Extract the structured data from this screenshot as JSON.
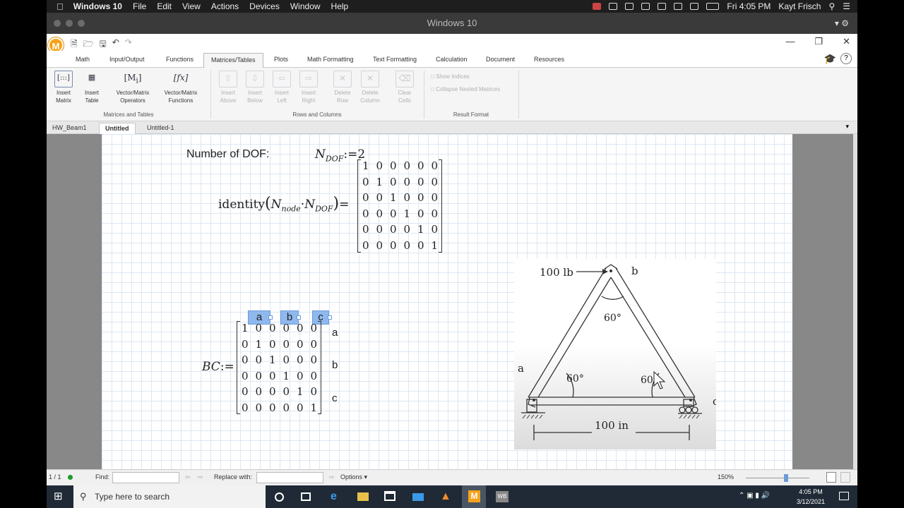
{
  "mac_menu": {
    "app_name": "Windows 10",
    "items": [
      "File",
      "Edit",
      "View",
      "Actions",
      "Devices",
      "Window",
      "Help"
    ],
    "datetime": "Fri 4:05 PM",
    "user": "Kayt Frisch"
  },
  "vm_title": "Windows 10",
  "ribbon": {
    "tabs": [
      "Math",
      "Input/Output",
      "Functions",
      "Matrices/Tables",
      "Plots",
      "Math Formatting",
      "Text Formatting",
      "Calculation",
      "Document",
      "Resources"
    ],
    "active_tab": "Matrices/Tables",
    "groups": {
      "matrices_and_tables": {
        "label": "Matrices and Tables",
        "buttons": [
          {
            "label1": "Insert",
            "label2": "Matrix",
            "icon": "insert-matrix-icon"
          },
          {
            "label1": "Insert",
            "label2": "Table",
            "icon": "insert-table-icon"
          },
          {
            "label1": "Vector/Matrix",
            "label2": "Operators",
            "icon": "matrix-operators-icon"
          },
          {
            "label1": "Vector/Matrix",
            "label2": "Functions",
            "icon": "matrix-functions-icon"
          }
        ]
      },
      "rows_and_columns": {
        "label": "Rows and Columns",
        "buttons": [
          {
            "label1": "Insert",
            "label2": "Above"
          },
          {
            "label1": "Insert",
            "label2": "Below"
          },
          {
            "label1": "Insert",
            "label2": "Left"
          },
          {
            "label1": "Insert",
            "label2": "Right"
          },
          {
            "label1": "Delete",
            "label2": "Row"
          },
          {
            "label1": "Delete",
            "label2": "Column"
          },
          {
            "label1": "Clear",
            "label2": "Cells"
          }
        ]
      },
      "result_format": {
        "label": "Result Format",
        "options": [
          "Show Indices",
          "Collapse Nested Matrices"
        ]
      }
    }
  },
  "doc_tabs": [
    "HW_Beam1",
    "Untitled",
    "Untitled-1"
  ],
  "active_doc_tab": "Untitled",
  "worksheet": {
    "dof_label": "Number of DOF:",
    "ndof_def": {
      "var": "N",
      "sub": "DOF",
      "op": ":=",
      "value": "2"
    },
    "identity_expr": {
      "fn": "identity",
      "arg1": "N",
      "sub1": "node",
      "dot": "·",
      "arg2": "N",
      "sub2": "DOF",
      "eq": "="
    },
    "identity_matrix": [
      [
        1,
        0,
        0,
        0,
        0,
        0
      ],
      [
        0,
        1,
        0,
        0,
        0,
        0
      ],
      [
        0,
        0,
        1,
        0,
        0,
        0
      ],
      [
        0,
        0,
        0,
        1,
        0,
        0
      ],
      [
        0,
        0,
        0,
        0,
        1,
        0
      ],
      [
        0,
        0,
        0,
        0,
        0,
        1
      ]
    ],
    "bc_def": {
      "var": "BC",
      "op": ":="
    },
    "bc_col_headers": [
      "a",
      "b",
      "c"
    ],
    "bc_row_labels": [
      "a",
      "b",
      "c"
    ],
    "bc_matrix": [
      [
        1,
        0,
        0,
        0,
        0,
        0
      ],
      [
        0,
        1,
        0,
        0,
        0,
        0
      ],
      [
        0,
        0,
        1,
        0,
        0,
        0
      ],
      [
        0,
        0,
        0,
        1,
        0,
        0
      ],
      [
        0,
        0,
        0,
        0,
        1,
        0
      ],
      [
        0,
        0,
        0,
        0,
        0,
        1
      ]
    ],
    "figure": {
      "load": "100 lb",
      "node_a": "a",
      "node_b": "b",
      "node_c": "c",
      "angle_top": "60°",
      "angle_left": "60°",
      "angle_right": "60",
      "span": "100 in"
    }
  },
  "status_bar": {
    "page": "1 / 1",
    "find_label": "Find:",
    "replace_label": "Replace with:",
    "options": "Options",
    "zoom": "150%"
  },
  "taskbar": {
    "search_placeholder": "Type here to search",
    "time": "4:05 PM",
    "date": "3/12/2021"
  }
}
